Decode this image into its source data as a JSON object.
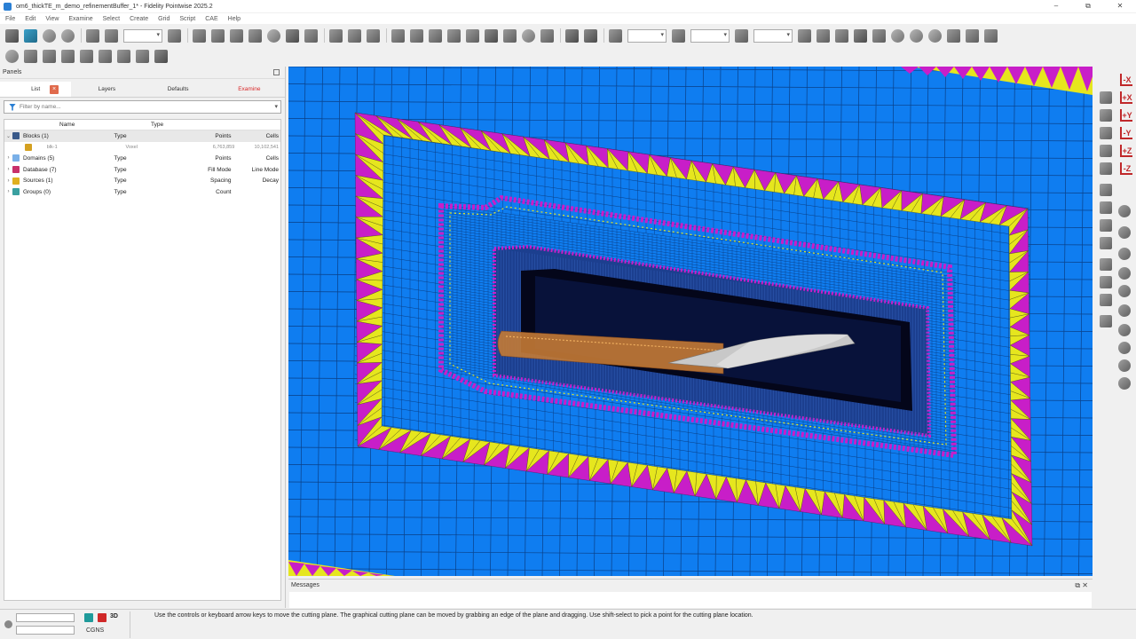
{
  "window": {
    "title": "om6_thickTE_m_demo_refinementBuffer_1* - Fidelity Pointwise 2025.2",
    "controls": [
      "–",
      "⧉",
      "✕"
    ]
  },
  "menu": [
    "File",
    "Edit",
    "View",
    "Examine",
    "Select",
    "Create",
    "Grid",
    "Script",
    "CAE",
    "Help"
  ],
  "panels": {
    "title": "Panels",
    "tabs": [
      {
        "label": "List"
      },
      {
        "label": "Layers"
      },
      {
        "label": "Defaults"
      },
      {
        "label": "Examine"
      }
    ],
    "filter_placeholder": "Filter by name...",
    "columns": {
      "name": "Name",
      "type": "Type"
    },
    "rows": [
      {
        "name": "Blocks (1)",
        "type": "Type",
        "a": "Points",
        "b": "Cells",
        "expanded": true,
        "icon_color": "#3a5a8a"
      },
      {
        "name": "blk-1",
        "type": "Voxel",
        "a": "6,763,859",
        "b": "10,102,541",
        "child": true,
        "icon_color": "#d4a020"
      },
      {
        "name": "Domains (5)",
        "type": "Type",
        "a": "Points",
        "b": "Cells",
        "icon_color": "#7ab0e8"
      },
      {
        "name": "Database (7)",
        "type": "Type",
        "a": "Fill Mode",
        "b": "Line Mode",
        "icon_color": "#c8306a"
      },
      {
        "name": "Sources (1)",
        "type": "Type",
        "a": "Spacing",
        "b": "Decay",
        "icon_color": "#e0b020"
      },
      {
        "name": "Groups (0)",
        "type": "Type",
        "a": "Count",
        "b": "",
        "icon_color": "#3aa0a0"
      }
    ]
  },
  "right_toolbar": {
    "axis_labels": [
      "-X",
      "+X",
      "+Y",
      "-Y",
      "+Z",
      "-Z"
    ]
  },
  "messages": {
    "title": "Messages",
    "controls": "⧉ ✕"
  },
  "statusbar": {
    "mode": "3D",
    "solver": "CGNS",
    "hint": "Use the controls or keyboard arrow keys to move the cutting plane. The graphical cutting plane can be moved by grabbing an edge of the plane and dragging. Use shift-select to pick a point for the cutting plane location.",
    "colors": {
      "led": "#888888",
      "cube_teal": "#1f9a9a",
      "cube_red": "#d02828"
    }
  },
  "viewport": {
    "colors": {
      "background": "#0f7df0",
      "grid_line": "#0a3f86",
      "buffer_magenta": "#c81ec8",
      "buffer_yellow": "#e6e61e",
      "dark_core": "#04061a",
      "wing": "#c8c8c8",
      "fuselage": "#c47a35"
    }
  }
}
